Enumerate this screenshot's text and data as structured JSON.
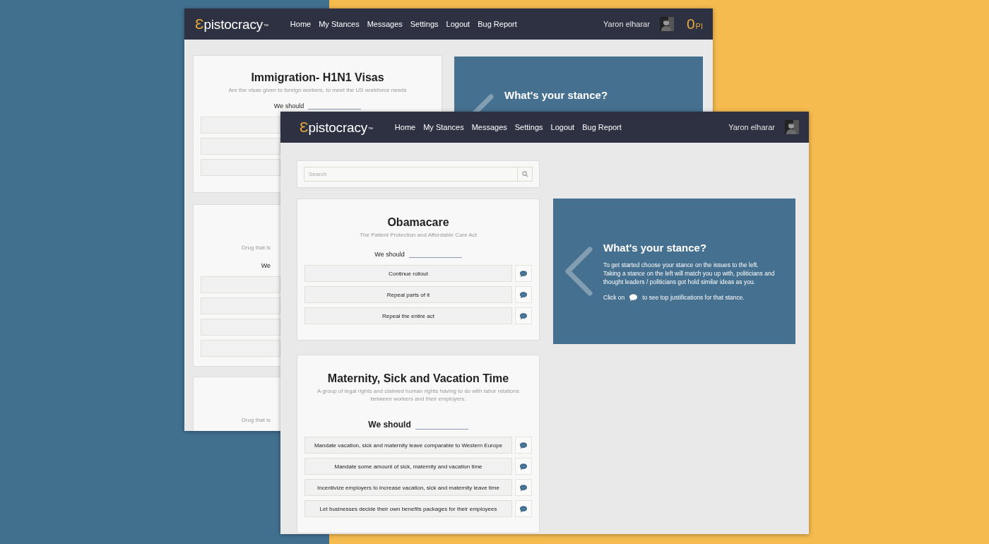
{
  "back_window": {
    "header": {
      "logo": {
        "mark": "Ɛ",
        "name": "pistocracy",
        "trademark": "™"
      },
      "nav": [
        "Home",
        "My Stances",
        "Messages",
        "Settings",
        "Logout",
        "Bug Report"
      ],
      "user": "Yaron elharar",
      "points": {
        "value": "0",
        "unit": "PI"
      }
    },
    "cards": [
      {
        "kind": "full",
        "title": "Immigration- H1N1 Visas",
        "subtitle": "Are the visas given to foreign workers, to meet the US workforce needs",
        "we_should": "We should",
        "options": [
          {
            "kind": "blank"
          },
          {
            "kind": "blank"
          },
          {
            "kind": "blank"
          }
        ]
      },
      {
        "kind": "clipped",
        "subtitle": "Drug that is",
        "we_should": "We",
        "options": [
          {
            "kind": "blank"
          },
          {
            "kind": "blank"
          },
          {
            "kind": "blank"
          },
          {
            "kind": "blank"
          }
        ]
      },
      {
        "kind": "clipped",
        "subtitle": "Drug that is"
      }
    ],
    "panel": {
      "title": "What's your stance?"
    }
  },
  "front_window": {
    "header": {
      "logo": {
        "mark": "Ɛ",
        "name": "pistocracy",
        "trademark": "™"
      },
      "nav": [
        "Home",
        "My Stances",
        "Messages",
        "Settings",
        "Logout",
        "Bug Report"
      ],
      "user": "Yaron elharar"
    },
    "search": {
      "placeholder": "Search"
    },
    "cards": [
      {
        "kind": "full",
        "title": "Obamacare",
        "subtitle": "The Patient Protection and Affordable Care Act",
        "we_should": "We should",
        "options": [
          {
            "kind": "stance",
            "label": "Continue rollout"
          },
          {
            "kind": "stance",
            "label": "Repeal parts of it"
          },
          {
            "kind": "stance",
            "label": "Repeal the entire act"
          }
        ]
      },
      {
        "kind": "full",
        "title": "Maternity, Sick and Vacation Time",
        "subtitle": "A group of legal rights and claimed human rights having to do with labor relations between workers and their employers.",
        "we_should": "We should",
        "options": [
          {
            "kind": "stance",
            "label": "Mandate vacation, sick and maternity leave comparable to Western Europe"
          },
          {
            "kind": "stance",
            "label": "Mandate some amount of sick, maternity and vacation time"
          },
          {
            "kind": "stance",
            "label": "Incentivize employers to increase vacation, sick and maternity leave time"
          },
          {
            "kind": "stance",
            "label": "Let businesses decide their own benefits packages for their employees"
          }
        ]
      }
    ],
    "panel": {
      "title": "What's your stance?",
      "intro": [
        "To get started choose your stance on the issues to the left.",
        "Taking a stance on the left will match you up with, politicians and thought leaders / politicians got hold similar ideas as you."
      ],
      "hint": {
        "before": "Click on",
        "after": "to see top justifications for that stance."
      }
    }
  }
}
